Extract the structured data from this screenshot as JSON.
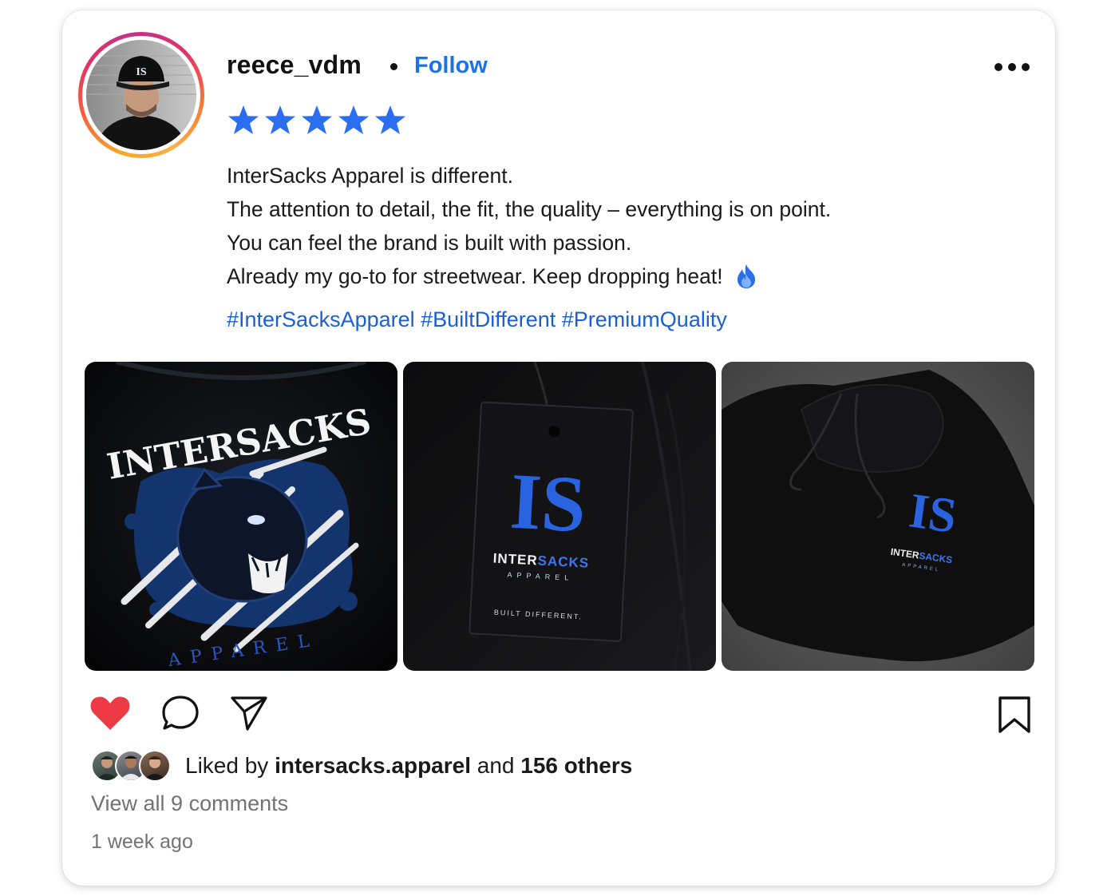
{
  "post": {
    "username": "reece_vdm",
    "follow_label": "Follow",
    "rating": 5,
    "review_lines": [
      "InterSacks Apparel is different.",
      "The attention to detail, the fit, the quality – everything is on point.",
      "You can feel the brand is built with passion.",
      "Already my go-to for streetwear. Keep dropping heat!"
    ],
    "hashtags": [
      "#InterSacksApparel",
      "#BuiltDifferent",
      "#PremiumQuality"
    ],
    "photos": [
      {
        "brand_text": "INTERSACKS",
        "sub_text": "APPAREL"
      },
      {
        "monogram": "IS",
        "brand_text_a": "INTER",
        "brand_text_b": "SACKS",
        "sub_text": "APPAREL",
        "tagline": "BUILT DIFFERENT."
      },
      {
        "monogram": "IS",
        "brand_text_a": "INTER",
        "brand_text_b": "SACKS",
        "sub_text": "APPAREL"
      }
    ],
    "avatar_cap_logo": "IS"
  },
  "engagement": {
    "liked_prefix": "Liked by",
    "liked_user": "intersacks.apparel",
    "liked_and": "and",
    "liked_others": "156 others",
    "view_comments": "View all 9 comments",
    "timestamp": "1 week ago",
    "liked": true
  },
  "colors": {
    "accent": "#1a73e8",
    "hashtag": "#1a5fd6",
    "star": "#2b6ef2",
    "heart": "#ed3a44",
    "brand_blue": "#2a63e0",
    "muted": "#737373"
  },
  "icons": [
    "more-options-icon",
    "star-icon",
    "fire-emoji-icon",
    "heart-icon",
    "comment-icon",
    "share-icon",
    "bookmark-icon"
  ]
}
